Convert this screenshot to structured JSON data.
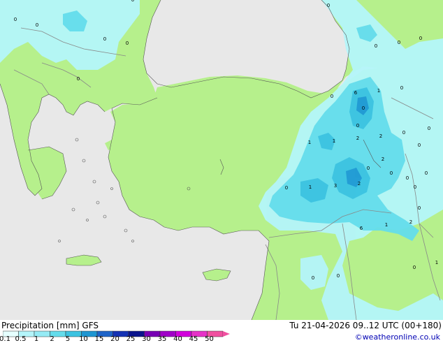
{
  "footer": {
    "title": "Precipitation [mm]",
    "model": "GFS",
    "datetime": "Tu 21-04-2026 09..12 UTC (00+180)",
    "credit": "©weatheronline.co.uk"
  },
  "colors": {
    "sea": "#e8e8e8",
    "land": "#b6f08c",
    "border": "#888888",
    "coast": "#555555"
  },
  "legend": {
    "ticks": [
      "0.1",
      "0.5",
      "1",
      "2",
      "5",
      "10",
      "15",
      "20",
      "25",
      "30",
      "35",
      "40",
      "45",
      "50"
    ],
    "colors": [
      "#e6ffff",
      "#b4f5fa",
      "#96ebf5",
      "#64dceb",
      "#3cc3e1",
      "#1e96d2",
      "#1e64c8",
      "#1432b4",
      "#0a148c",
      "#7800b4",
      "#a000c8",
      "#d200dc",
      "#e632c8",
      "#f050a0"
    ]
  },
  "map_labels": [
    "0",
    "0",
    "0",
    "0",
    "0",
    "0",
    "0",
    "0",
    "0",
    "0",
    "0",
    "0",
    "0",
    "0",
    "6",
    "1",
    "0",
    "1",
    "1",
    "2",
    "2",
    "2",
    "0",
    "0",
    "0",
    "1",
    "3",
    "2",
    "6",
    "1",
    "2",
    "1",
    "0",
    "0",
    "0",
    "0",
    "0",
    "0",
    "0",
    "0",
    "0"
  ]
}
